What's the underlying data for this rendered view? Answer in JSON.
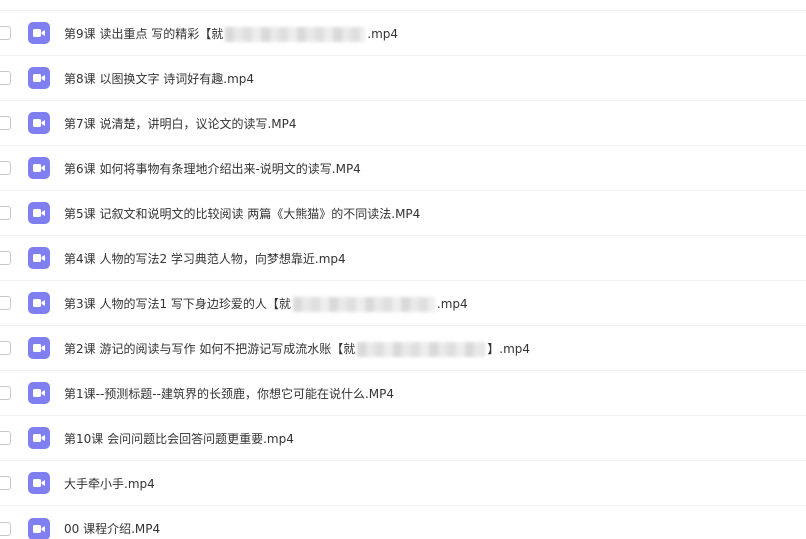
{
  "files": [
    {
      "name_prefix": "第9课 读出重点 写的精彩【就",
      "name_suffix": ".mp4"
    },
    {
      "name_prefix": "第8课 以图换文字 诗词好有趣.mp4",
      "name_suffix": ""
    },
    {
      "name_prefix": "第7课 说清楚，讲明白，议论文的读写.MP4",
      "name_suffix": ""
    },
    {
      "name_prefix": "第6课 如何将事物有条理地介绍出来-说明文的读写.MP4",
      "name_suffix": ""
    },
    {
      "name_prefix": "第5课 记叙文和说明文的比较阅读 两篇《大熊猫》的不同读法.MP4",
      "name_suffix": ""
    },
    {
      "name_prefix": "第4课 人物的写法2 学习典范人物，向梦想靠近.mp4",
      "name_suffix": ""
    },
    {
      "name_prefix": "第3课 人物的写法1 写下身边珍爱的人【就",
      "name_suffix": ".mp4"
    },
    {
      "name_prefix": "第2课 游记的阅读与写作 如何不把游记写成流水账【就",
      "name_suffix": "】.mp4"
    },
    {
      "name_prefix": "第1课--预测标题--建筑界的长颈鹿，你想它可能在说什么.MP4",
      "name_suffix": ""
    },
    {
      "name_prefix": "第10课 会问问题比会回答问题更重要.mp4",
      "name_suffix": ""
    },
    {
      "name_prefix": "大手牵小手.mp4",
      "name_suffix": ""
    },
    {
      "name_prefix": "00 课程介绍.MP4",
      "name_suffix": ""
    }
  ],
  "icon": {
    "name": "video-file-icon",
    "color": "#7f7ff0"
  }
}
